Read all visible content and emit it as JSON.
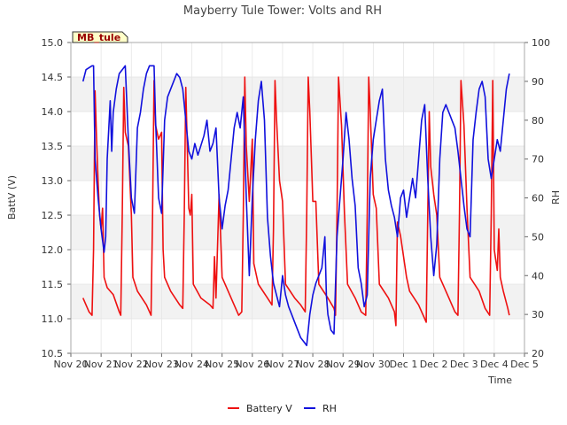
{
  "chart_data": {
    "type": "line",
    "title": "Mayberry Tule Tower: Volts and RH",
    "tag": "MB_tule",
    "xlabel": "Time",
    "ylabel_left": "BattV (V)",
    "ylabel_right": "RH",
    "x_ticks": [
      "Nov 20",
      "Nov 21",
      "Nov 22",
      "Nov 23",
      "Nov 24",
      "Nov 25",
      "Nov 26",
      "Nov 27",
      "Nov 28",
      "Nov 29",
      "Nov 30",
      "Dec 1",
      "Dec 2",
      "Dec 3",
      "Dec 4",
      "Dec 5"
    ],
    "xlim_days": [
      0,
      15
    ],
    "ylim_left": [
      10.5,
      15.0
    ],
    "yticks_left": [
      "10.5",
      "11.0",
      "11.5",
      "12.0",
      "12.5",
      "13.0",
      "13.5",
      "14.0",
      "14.5",
      "15.0"
    ],
    "ylim_right": [
      20,
      100
    ],
    "yticks_right": [
      "20",
      "30",
      "40",
      "50",
      "60",
      "70",
      "80",
      "90",
      "100"
    ],
    "grid_bands": true,
    "legend_placement": "bottom-center",
    "series": [
      {
        "name": "Battery V",
        "axis": "left",
        "color": "#ee1111",
        "points": [
          [
            0.4,
            11.3
          ],
          [
            0.6,
            11.1
          ],
          [
            0.7,
            11.05
          ],
          [
            0.75,
            12.0
          ],
          [
            0.8,
            14.3
          ],
          [
            0.85,
            13.6
          ],
          [
            0.9,
            13.0
          ],
          [
            0.95,
            12.5
          ],
          [
            1.0,
            12.3
          ],
          [
            1.05,
            12.6
          ],
          [
            1.1,
            11.6
          ],
          [
            1.2,
            11.45
          ],
          [
            1.4,
            11.35
          ],
          [
            1.6,
            11.1
          ],
          [
            1.65,
            11.05
          ],
          [
            1.7,
            12.5
          ],
          [
            1.75,
            14.35
          ],
          [
            1.8,
            13.7
          ],
          [
            1.9,
            13.5
          ],
          [
            2.0,
            12.5
          ],
          [
            2.05,
            11.6
          ],
          [
            2.2,
            11.4
          ],
          [
            2.5,
            11.2
          ],
          [
            2.65,
            11.05
          ],
          [
            2.7,
            12.5
          ],
          [
            2.75,
            14.45
          ],
          [
            2.8,
            13.8
          ],
          [
            2.9,
            13.6
          ],
          [
            3.0,
            13.7
          ],
          [
            3.05,
            12.0
          ],
          [
            3.1,
            11.6
          ],
          [
            3.3,
            11.4
          ],
          [
            3.6,
            11.2
          ],
          [
            3.7,
            11.15
          ],
          [
            3.75,
            12.5
          ],
          [
            3.8,
            14.35
          ],
          [
            3.85,
            13.5
          ],
          [
            3.9,
            12.6
          ],
          [
            3.95,
            12.5
          ],
          [
            4.0,
            12.8
          ],
          [
            4.05,
            11.5
          ],
          [
            4.3,
            11.3
          ],
          [
            4.6,
            11.2
          ],
          [
            4.7,
            11.15
          ],
          [
            4.75,
            11.9
          ],
          [
            4.8,
            11.3
          ],
          [
            4.9,
            12.8
          ],
          [
            5.0,
            11.6
          ],
          [
            5.2,
            11.4
          ],
          [
            5.4,
            11.2
          ],
          [
            5.55,
            11.05
          ],
          [
            5.65,
            11.1
          ],
          [
            5.7,
            12.5
          ],
          [
            5.75,
            14.5
          ],
          [
            5.8,
            13.5
          ],
          [
            5.9,
            12.7
          ],
          [
            6.0,
            13.6
          ],
          [
            6.05,
            11.8
          ],
          [
            6.2,
            11.5
          ],
          [
            6.5,
            11.3
          ],
          [
            6.65,
            11.2
          ],
          [
            6.7,
            12.3
          ],
          [
            6.75,
            14.45
          ],
          [
            6.8,
            13.9
          ],
          [
            6.9,
            13.0
          ],
          [
            7.0,
            12.7
          ],
          [
            7.1,
            11.5
          ],
          [
            7.4,
            11.3
          ],
          [
            7.6,
            11.2
          ],
          [
            7.75,
            11.1
          ],
          [
            7.8,
            12.5
          ],
          [
            7.85,
            14.5
          ],
          [
            7.9,
            14.0
          ],
          [
            8.0,
            12.7
          ],
          [
            8.1,
            12.7
          ],
          [
            8.2,
            11.5
          ],
          [
            8.5,
            11.3
          ],
          [
            8.7,
            11.15
          ],
          [
            8.75,
            11.05
          ],
          [
            8.8,
            12.5
          ],
          [
            8.85,
            14.5
          ],
          [
            8.95,
            13.8
          ],
          [
            9.05,
            12.5
          ],
          [
            9.15,
            11.5
          ],
          [
            9.4,
            11.3
          ],
          [
            9.6,
            11.1
          ],
          [
            9.75,
            11.05
          ],
          [
            9.8,
            12.5
          ],
          [
            9.85,
            14.5
          ],
          [
            9.9,
            14.0
          ],
          [
            10.0,
            12.8
          ],
          [
            10.1,
            12.6
          ],
          [
            10.2,
            11.5
          ],
          [
            10.5,
            11.3
          ],
          [
            10.7,
            11.1
          ],
          [
            10.75,
            10.9
          ],
          [
            10.8,
            12.4
          ],
          [
            10.9,
            12.2
          ],
          [
            11.0,
            11.9
          ],
          [
            11.1,
            11.6
          ],
          [
            11.2,
            11.4
          ],
          [
            11.5,
            11.2
          ],
          [
            11.7,
            11.0
          ],
          [
            11.75,
            10.95
          ],
          [
            11.8,
            12.5
          ],
          [
            11.85,
            14.0
          ],
          [
            11.9,
            13.2
          ],
          [
            12.0,
            12.8
          ],
          [
            12.1,
            12.5
          ],
          [
            12.2,
            11.6
          ],
          [
            12.5,
            11.3
          ],
          [
            12.7,
            11.1
          ],
          [
            12.8,
            11.05
          ],
          [
            12.85,
            12.5
          ],
          [
            12.9,
            14.45
          ],
          [
            13.0,
            13.8
          ],
          [
            13.1,
            12.6
          ],
          [
            13.2,
            11.6
          ],
          [
            13.5,
            11.4
          ],
          [
            13.7,
            11.15
          ],
          [
            13.85,
            11.05
          ],
          [
            13.9,
            12.5
          ],
          [
            13.95,
            14.45
          ],
          [
            14.0,
            12.0
          ],
          [
            14.1,
            11.7
          ],
          [
            14.15,
            12.3
          ],
          [
            14.2,
            11.6
          ],
          [
            14.3,
            11.4
          ],
          [
            14.45,
            11.15
          ],
          [
            14.5,
            11.05
          ]
        ]
      },
      {
        "name": "RH",
        "axis": "right",
        "color": "#1111dd",
        "points": [
          [
            0.4,
            90
          ],
          [
            0.5,
            93
          ],
          [
            0.7,
            94
          ],
          [
            0.75,
            94
          ],
          [
            0.8,
            70
          ],
          [
            0.9,
            60
          ],
          [
            1.0,
            52
          ],
          [
            1.1,
            46
          ],
          [
            1.15,
            50
          ],
          [
            1.2,
            70
          ],
          [
            1.3,
            85
          ],
          [
            1.35,
            72
          ],
          [
            1.4,
            82
          ],
          [
            1.5,
            88
          ],
          [
            1.6,
            92
          ],
          [
            1.7,
            93
          ],
          [
            1.8,
            94
          ],
          [
            1.9,
            75
          ],
          [
            2.0,
            60
          ],
          [
            2.1,
            56
          ],
          [
            2.2,
            78
          ],
          [
            2.3,
            82
          ],
          [
            2.4,
            88
          ],
          [
            2.5,
            92
          ],
          [
            2.6,
            94
          ],
          [
            2.75,
            94
          ],
          [
            2.8,
            80
          ],
          [
            2.9,
            60
          ],
          [
            3.0,
            56
          ],
          [
            3.1,
            80
          ],
          [
            3.2,
            86
          ],
          [
            3.3,
            88
          ],
          [
            3.5,
            92
          ],
          [
            3.6,
            91
          ],
          [
            3.7,
            88
          ],
          [
            3.8,
            80
          ],
          [
            3.9,
            72
          ],
          [
            4.0,
            70
          ],
          [
            4.1,
            74
          ],
          [
            4.2,
            71
          ],
          [
            4.4,
            76
          ],
          [
            4.5,
            80
          ],
          [
            4.6,
            72
          ],
          [
            4.7,
            74
          ],
          [
            4.8,
            78
          ],
          [
            4.9,
            60
          ],
          [
            5.0,
            52
          ],
          [
            5.1,
            58
          ],
          [
            5.2,
            62
          ],
          [
            5.3,
            70
          ],
          [
            5.4,
            78
          ],
          [
            5.5,
            82
          ],
          [
            5.6,
            78
          ],
          [
            5.7,
            86
          ],
          [
            5.8,
            60
          ],
          [
            5.9,
            40
          ],
          [
            6.0,
            60
          ],
          [
            6.1,
            75
          ],
          [
            6.2,
            85
          ],
          [
            6.3,
            90
          ],
          [
            6.4,
            80
          ],
          [
            6.5,
            55
          ],
          [
            6.6,
            45
          ],
          [
            6.7,
            38
          ],
          [
            6.8,
            35
          ],
          [
            6.9,
            32
          ],
          [
            7.0,
            40
          ],
          [
            7.1,
            35
          ],
          [
            7.2,
            32
          ],
          [
            7.3,
            30
          ],
          [
            7.4,
            28
          ],
          [
            7.5,
            26
          ],
          [
            7.6,
            24
          ],
          [
            7.7,
            23
          ],
          [
            7.8,
            22
          ],
          [
            7.9,
            30
          ],
          [
            8.0,
            35
          ],
          [
            8.1,
            38
          ],
          [
            8.2,
            40
          ],
          [
            8.3,
            42
          ],
          [
            8.4,
            50
          ],
          [
            8.45,
            35
          ],
          [
            8.5,
            30
          ],
          [
            8.6,
            26
          ],
          [
            8.7,
            25
          ],
          [
            8.8,
            50
          ],
          [
            8.9,
            60
          ],
          [
            9.0,
            70
          ],
          [
            9.1,
            82
          ],
          [
            9.2,
            75
          ],
          [
            9.3,
            65
          ],
          [
            9.4,
            58
          ],
          [
            9.5,
            42
          ],
          [
            9.6,
            38
          ],
          [
            9.7,
            32
          ],
          [
            9.8,
            35
          ],
          [
            9.9,
            65
          ],
          [
            10.0,
            75
          ],
          [
            10.1,
            80
          ],
          [
            10.2,
            85
          ],
          [
            10.3,
            88
          ],
          [
            10.4,
            70
          ],
          [
            10.5,
            62
          ],
          [
            10.6,
            58
          ],
          [
            10.7,
            55
          ],
          [
            10.8,
            50
          ],
          [
            10.9,
            60
          ],
          [
            11.0,
            62
          ],
          [
            11.1,
            55
          ],
          [
            11.2,
            60
          ],
          [
            11.3,
            65
          ],
          [
            11.4,
            60
          ],
          [
            11.5,
            70
          ],
          [
            11.6,
            80
          ],
          [
            11.7,
            84
          ],
          [
            11.8,
            65
          ],
          [
            11.9,
            50
          ],
          [
            12.0,
            40
          ],
          [
            12.1,
            48
          ],
          [
            12.2,
            70
          ],
          [
            12.3,
            82
          ],
          [
            12.4,
            84
          ],
          [
            12.5,
            82
          ],
          [
            12.6,
            80
          ],
          [
            12.7,
            78
          ],
          [
            12.8,
            72
          ],
          [
            12.9,
            65
          ],
          [
            13.0,
            58
          ],
          [
            13.1,
            52
          ],
          [
            13.2,
            50
          ],
          [
            13.3,
            75
          ],
          [
            13.4,
            82
          ],
          [
            13.5,
            88
          ],
          [
            13.6,
            90
          ],
          [
            13.7,
            86
          ],
          [
            13.8,
            70
          ],
          [
            13.9,
            65
          ],
          [
            14.0,
            70
          ],
          [
            14.1,
            75
          ],
          [
            14.2,
            72
          ],
          [
            14.3,
            80
          ],
          [
            14.4,
            88
          ],
          [
            14.5,
            92
          ]
        ]
      }
    ]
  },
  "legend": [
    {
      "label": "Battery V",
      "color": "#ee1111"
    },
    {
      "label": "RH",
      "color": "#1111dd"
    }
  ]
}
